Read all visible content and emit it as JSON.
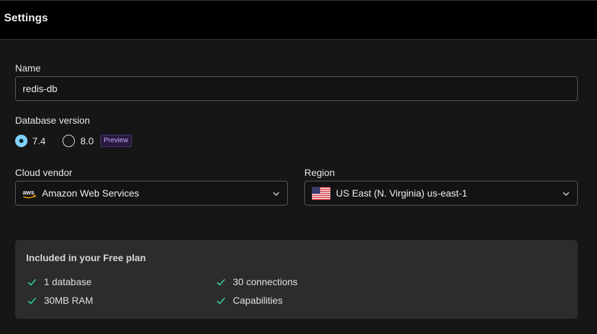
{
  "header": {
    "title": "Settings"
  },
  "name": {
    "label": "Name",
    "value": "redis-db"
  },
  "version": {
    "label": "Database version",
    "options": [
      {
        "label": "7.4",
        "selected": true
      },
      {
        "label": "8.0",
        "selected": false,
        "badge": "Preview"
      }
    ]
  },
  "vendor": {
    "label": "Cloud vendor",
    "value": "Amazon Web Services",
    "icon": "aws-logo-icon"
  },
  "region": {
    "label": "Region",
    "value": "US East (N. Virginia) us-east-1",
    "icon": "us-flag-icon"
  },
  "plan": {
    "title": "Included in your Free plan",
    "features": [
      "1 database",
      "30 connections",
      "30MB RAM",
      "Capabilities"
    ]
  },
  "colors": {
    "accent": "#7fd0ff",
    "check": "#2fd6a0",
    "badge_text": "#c9a8ff"
  }
}
